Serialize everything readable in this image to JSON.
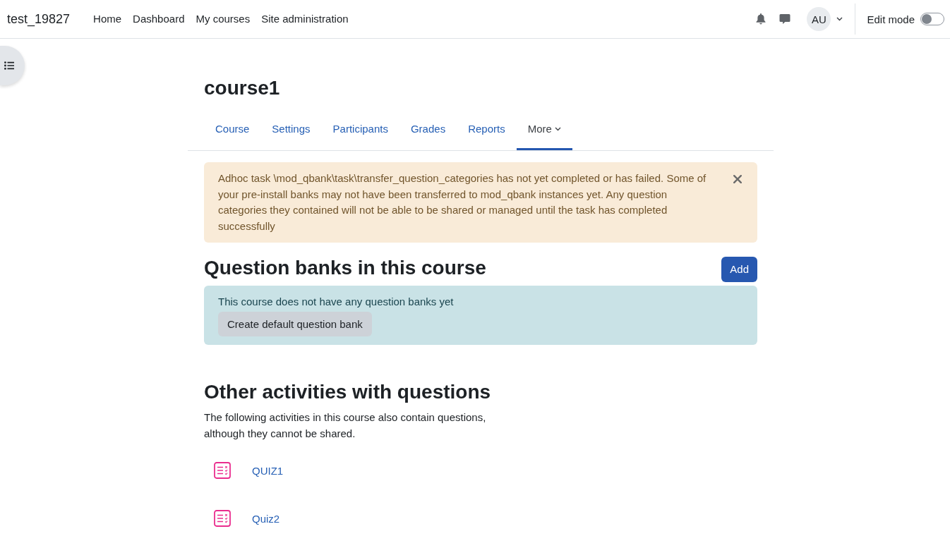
{
  "navbar": {
    "site_name": "test_19827",
    "links": [
      {
        "label": "Home"
      },
      {
        "label": "Dashboard"
      },
      {
        "label": "My courses"
      },
      {
        "label": "Site administration"
      }
    ],
    "avatar": "AU",
    "edit_mode": {
      "label": "Edit mode",
      "on": false
    }
  },
  "page": {
    "title": "course1"
  },
  "tabs": [
    {
      "label": "Course",
      "kind": "link",
      "selected": false
    },
    {
      "label": "Settings",
      "kind": "link",
      "selected": false
    },
    {
      "label": "Participants",
      "kind": "link",
      "selected": false
    },
    {
      "label": "Grades",
      "kind": "link",
      "selected": false
    },
    {
      "label": "Reports",
      "kind": "link",
      "selected": false
    },
    {
      "label": "More",
      "kind": "menu",
      "selected": true
    }
  ],
  "warning": {
    "text": "Adhoc task \\mod_qbank\\task\\transfer_question_categories has not yet completed or has failed. Some of your pre-install banks may not have been transferred to mod_qbank instances yet. Any question categories they contained will not be able to be shared or managed until the task has completed successfully"
  },
  "question_banks": {
    "title": "Question banks in this course",
    "add_button": "Add",
    "notice": "This course does not have any question banks yet",
    "create_button": "Create default question bank"
  },
  "other_activities": {
    "title": "Other activities with questions",
    "description": "The following activities in this course also contain questions, although they cannot be shared.",
    "items": [
      {
        "name": "QUIZ1"
      },
      {
        "name": "Quiz2"
      }
    ]
  }
}
